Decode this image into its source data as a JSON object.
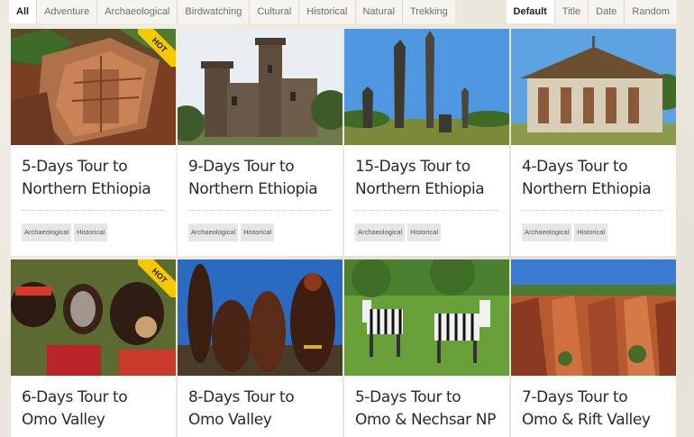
{
  "filters": [
    "All",
    "Adventure",
    "Archaeological",
    "Birdwatching",
    "Cultural",
    "Historical",
    "Natural",
    "Trekking"
  ],
  "filter_active": "All",
  "sorts": [
    "Default",
    "Title",
    "Date",
    "Random"
  ],
  "sort_active": "Default",
  "cards": [
    {
      "title": "5-Days Tour to Northern Ethiopia",
      "tags": [
        "Archaeological",
        "Historical"
      ],
      "hot": "HOT",
      "image": "rock-church"
    },
    {
      "title": "9-Days Tour to Northern Ethiopia",
      "tags": [
        "Archaeological",
        "Historical"
      ],
      "hot": "",
      "image": "castle"
    },
    {
      "title": "15-Days Tour to Northern Ethiopia",
      "tags": [
        "Archaeological",
        "Historical"
      ],
      "hot": "",
      "image": "obelisks"
    },
    {
      "title": "4-Days Tour to Northern Ethiopia",
      "tags": [
        "Archaeological",
        "Historical"
      ],
      "hot": "",
      "image": "round-church"
    },
    {
      "title": "6-Days Tour to Omo Valley",
      "tags": [],
      "hot": "HOT",
      "image": "tribe-portrait"
    },
    {
      "title": "8-Days Tour to Omo Valley",
      "tags": [],
      "hot": "",
      "image": "tribe-group"
    },
    {
      "title": "5-Days Tour to Omo & Nechsar NP",
      "tags": [],
      "hot": "",
      "image": "zebras"
    },
    {
      "title": "7-Days Tour to Omo & Rift Valley",
      "tags": [],
      "hot": "",
      "image": "canyon"
    }
  ],
  "colors": {
    "hot_ribbon": "#f6c800",
    "page_bg": "#ece7dc",
    "card_bg": "#ffffff"
  }
}
